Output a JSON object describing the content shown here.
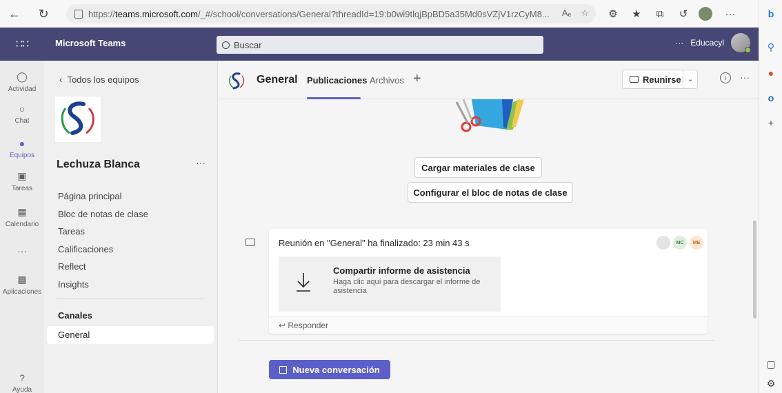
{
  "browser": {
    "url_prefix": "https://",
    "url_host": "teams.microsoft.com",
    "url_rest": "/_#/school/conversations/General?threadId=19:b0wi9tlqjBpBD5a35Md0sVZjV1rzCyM8...",
    "read_aloud": "Aₑ",
    "more": "···"
  },
  "teams": {
    "app_name": "Microsoft Teams",
    "search_placeholder": "Buscar",
    "more": "···",
    "org_name": "Educacyl"
  },
  "rail": {
    "items": [
      {
        "label": "Actividad",
        "icon": "bell-icon"
      },
      {
        "label": "Chat",
        "icon": "chat-icon"
      },
      {
        "label": "Equipos",
        "icon": "teams-icon"
      },
      {
        "label": "Tareas",
        "icon": "assignments-icon"
      },
      {
        "label": "Calendario",
        "icon": "calendar-icon"
      },
      {
        "label": "···",
        "icon": "more-icon"
      },
      {
        "label": "Aplicaciones",
        "icon": "apps-icon"
      },
      {
        "label": "Ayuda",
        "icon": "help-icon"
      }
    ]
  },
  "team_panel": {
    "back_label": "Todos los equipos",
    "team_name": "Lechuza Blanca",
    "more": "···",
    "nav": [
      "Página principal",
      "Bloc de notas de clase",
      "Tareas",
      "Calificaciones",
      "Reflect",
      "Insights"
    ],
    "channels_heading": "Canales",
    "channels": [
      "General"
    ]
  },
  "channel": {
    "title": "General",
    "tabs": [
      "Publicaciones",
      "Archivos"
    ],
    "add_tab": "+",
    "meet_label": "Reunirse",
    "info": "i",
    "more": "···"
  },
  "feed": {
    "upload_button": "Cargar materiales de clase",
    "notebook_button": "Configurar el bloc de notas de clase",
    "post": {
      "title": "Reunión en \"General\" ha finalizado: 23 min 43 s",
      "avatars": [
        "",
        "MC",
        "ME"
      ],
      "attachment_title": "Compartir informe de asistencia",
      "attachment_desc": "Haga clic aquí para descargar el informe de asistencia",
      "reply_label": "Responder"
    },
    "new_conversation": "Nueva conversación"
  },
  "colors": {
    "teams_purple": "#464775",
    "accent": "#5b5fc7"
  }
}
